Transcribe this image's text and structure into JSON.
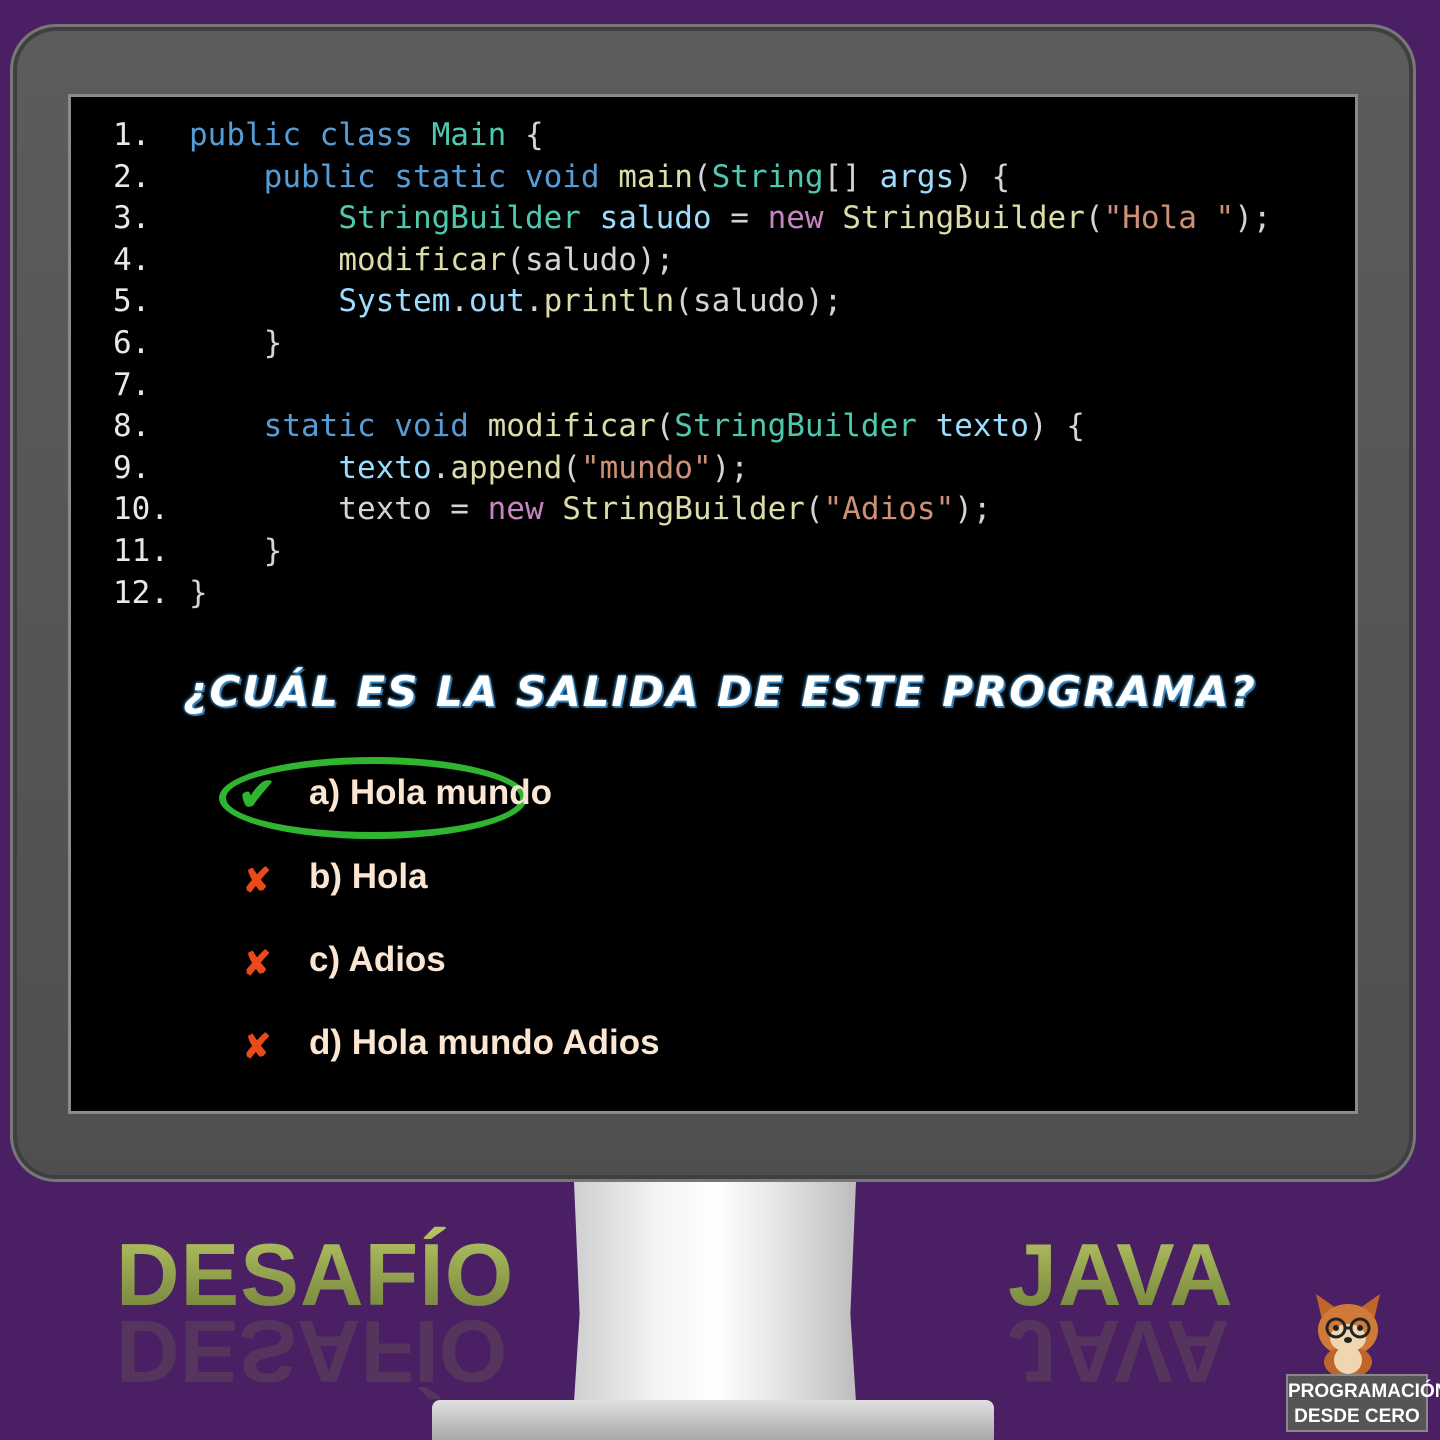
{
  "code_lines": [
    {
      "n": "1.",
      "segs": [
        [
          "kw",
          "public class "
        ],
        [
          "ty",
          "Main"
        ],
        [
          "p",
          " {"
        ]
      ]
    },
    {
      "n": "2.",
      "segs": [
        [
          "p",
          "    "
        ],
        [
          "kw",
          "public static void "
        ],
        [
          "fn",
          "main"
        ],
        [
          "p",
          "("
        ],
        [
          "ty",
          "String"
        ],
        [
          "p",
          "[] "
        ],
        [
          "vr",
          "args"
        ],
        [
          "p",
          ") {"
        ]
      ]
    },
    {
      "n": "3.",
      "segs": [
        [
          "p",
          "        "
        ],
        [
          "ty",
          "StringBuilder "
        ],
        [
          "vr",
          "saludo"
        ],
        [
          "p",
          " = "
        ],
        [
          "pk",
          "new "
        ],
        [
          "fn",
          "StringBuilder"
        ],
        [
          "p",
          "("
        ],
        [
          "st",
          "\"Hola \""
        ],
        [
          "p",
          ");"
        ]
      ]
    },
    {
      "n": "4.",
      "segs": [
        [
          "p",
          "        "
        ],
        [
          "fn",
          "modificar"
        ],
        [
          "p",
          "(saludo);"
        ]
      ]
    },
    {
      "n": "5.",
      "segs": [
        [
          "p",
          "        "
        ],
        [
          "vr",
          "System"
        ],
        [
          "p",
          "."
        ],
        [
          "vr",
          "out"
        ],
        [
          "p",
          "."
        ],
        [
          "fn",
          "println"
        ],
        [
          "p",
          "(saludo);"
        ]
      ]
    },
    {
      "n": "6.",
      "segs": [
        [
          "p",
          "    }"
        ]
      ]
    },
    {
      "n": "7.",
      "segs": []
    },
    {
      "n": "8.",
      "segs": [
        [
          "p",
          "    "
        ],
        [
          "kw",
          "static void "
        ],
        [
          "fn",
          "modificar"
        ],
        [
          "p",
          "("
        ],
        [
          "ty",
          "StringBuilder "
        ],
        [
          "vr",
          "texto"
        ],
        [
          "p",
          ") {"
        ]
      ]
    },
    {
      "n": "9.",
      "segs": [
        [
          "p",
          "        "
        ],
        [
          "vr",
          "texto"
        ],
        [
          "p",
          "."
        ],
        [
          "fn",
          "append"
        ],
        [
          "p",
          "("
        ],
        [
          "st",
          "\"mundo\""
        ],
        [
          "p",
          ");"
        ]
      ]
    },
    {
      "n": "10.",
      "segs": [
        [
          "p",
          "        texto = "
        ],
        [
          "pk",
          "new "
        ],
        [
          "fn",
          "StringBuilder"
        ],
        [
          "p",
          "("
        ],
        [
          "st",
          "\"Adios\""
        ],
        [
          "p",
          ");"
        ]
      ]
    },
    {
      "n": "11.",
      "segs": [
        [
          "p",
          "    }"
        ]
      ]
    },
    {
      "n": "12.",
      "segs": [
        [
          "p",
          "}"
        ]
      ]
    }
  ],
  "question": "¿CUÁL ES LA SALIDA DE ESTE PROGRAMA?",
  "options": [
    {
      "label": "a) Hola mundo",
      "correct": true,
      "icon": "check-icon"
    },
    {
      "label": "b) Hola",
      "correct": false,
      "icon": "cross-icon"
    },
    {
      "label": "c) Adios",
      "correct": false,
      "icon": "cross-icon"
    },
    {
      "label": "d) Hola mundo Adios",
      "correct": false,
      "icon": "cross-icon"
    }
  ],
  "footer": {
    "left": "DESAFÍO",
    "right": "JAVA"
  },
  "logo": {
    "line1": "PROGRAMACIÓN",
    "line2": "DESDE CERO"
  },
  "colors": {
    "background": "#4a1f63",
    "correct": "#2fb52f",
    "wrong": "#e84a1a"
  }
}
